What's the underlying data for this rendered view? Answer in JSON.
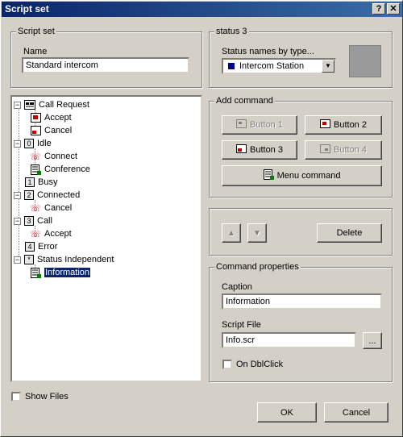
{
  "window": {
    "title": "Script set",
    "help": "?",
    "close": "✕"
  },
  "script_set": {
    "group_label": "Script set",
    "name_label": "Name",
    "name_value": "Standard intercom"
  },
  "status": {
    "group_label": "status 3",
    "names_label": "Status names by type...",
    "selected_type": "Intercom Station",
    "type_color": "#00008b",
    "swatch_color": "#9a9a9a"
  },
  "tree": {
    "items": [
      {
        "label": "Call Request",
        "badge": "",
        "icon": "phone-panel-icon",
        "level": 0
      },
      {
        "label": "Accept",
        "icon": "accept-icon",
        "level": 1
      },
      {
        "label": "Cancel",
        "icon": "cancel-icon",
        "level": 1
      },
      {
        "label": "Idle",
        "badge": "0",
        "level": 0
      },
      {
        "label": "Connect",
        "icon": "handset-icon",
        "level": 1
      },
      {
        "label": "Conference",
        "icon": "script-icon",
        "level": 1
      },
      {
        "label": "Busy",
        "badge": "1",
        "level": 0
      },
      {
        "label": "Connected",
        "badge": "2",
        "level": 0
      },
      {
        "label": "Cancel",
        "icon": "handset-icon",
        "level": 1
      },
      {
        "label": "Call",
        "badge": "3",
        "level": 0
      },
      {
        "label": "Accept",
        "icon": "handset-icon",
        "level": 1
      },
      {
        "label": "Error",
        "badge": "4",
        "level": 0
      },
      {
        "label": "Status Independent",
        "badge": "*",
        "level": 0
      },
      {
        "label": "Information",
        "icon": "script-icon",
        "level": 1,
        "selected": true
      }
    ]
  },
  "add_command": {
    "group_label": "Add command",
    "button1": "Button 1",
    "button2": "Button 2",
    "button3": "Button 3",
    "button4": "Button 4",
    "menu_command": "Menu command"
  },
  "move": {
    "up": "▲",
    "down": "▼",
    "delete": "Delete"
  },
  "properties": {
    "group_label": "Command properties",
    "caption_label": "Caption",
    "caption_value": "Information",
    "script_label": "Script File",
    "script_value": "Info.scr",
    "browse": "...",
    "dblclick_label": "On DblClick"
  },
  "footer": {
    "show_files": "Show Files",
    "ok": "OK",
    "cancel": "Cancel"
  }
}
